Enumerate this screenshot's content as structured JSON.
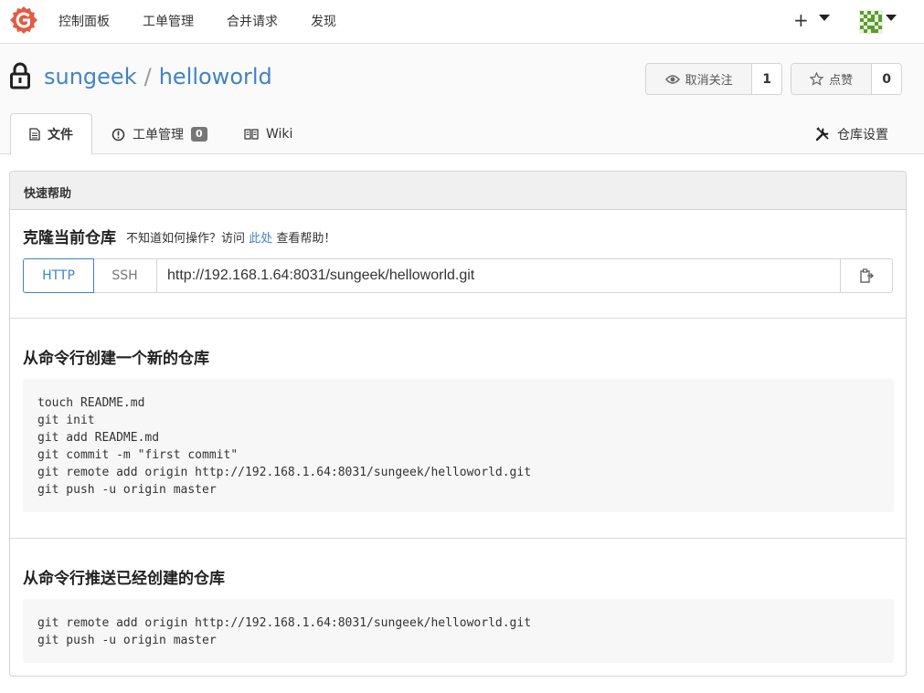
{
  "navbar": {
    "items": [
      {
        "label": "控制面板"
      },
      {
        "label": "工单管理"
      },
      {
        "label": "合并请求"
      },
      {
        "label": "发现"
      }
    ],
    "plus": "+",
    "brand_color": "#e05d44"
  },
  "repo": {
    "owner": "sungeek",
    "separator": "/",
    "name": "helloworld",
    "watch": {
      "label": "取消关注",
      "count": "1"
    },
    "star": {
      "label": "点赞",
      "count": "0"
    }
  },
  "tabs": [
    {
      "label": "文件"
    },
    {
      "label": "工单管理",
      "badge": "0"
    },
    {
      "label": "Wiki"
    }
  ],
  "settings_label": "仓库设置",
  "quick_help": {
    "header": "快速帮助",
    "clone_title": "克隆当前仓库",
    "clone_help_prefix": "不知道如何操作？访问",
    "clone_help_link": "此处",
    "clone_help_suffix": "查看帮助！",
    "http_label": "HTTP",
    "ssh_label": "SSH",
    "clone_url": "http://192.168.1.64:8031/sungeek/helloworld.git"
  },
  "new_repo": {
    "title": "从命令行创建一个新的仓库",
    "lines": [
      "touch README.md",
      "git init",
      "git add README.md",
      "git commit -m \"first commit\"",
      "git remote add origin http://192.168.1.64:8031/sungeek/helloworld.git",
      "git push -u origin master"
    ]
  },
  "push_existing": {
    "title": "从命令行推送已经创建的仓库",
    "lines": [
      "git remote add origin http://192.168.1.64:8031/sungeek/helloworld.git",
      "git push -u origin master"
    ]
  },
  "colors": {
    "link": "#4183c4",
    "accent": "#e05d44"
  }
}
